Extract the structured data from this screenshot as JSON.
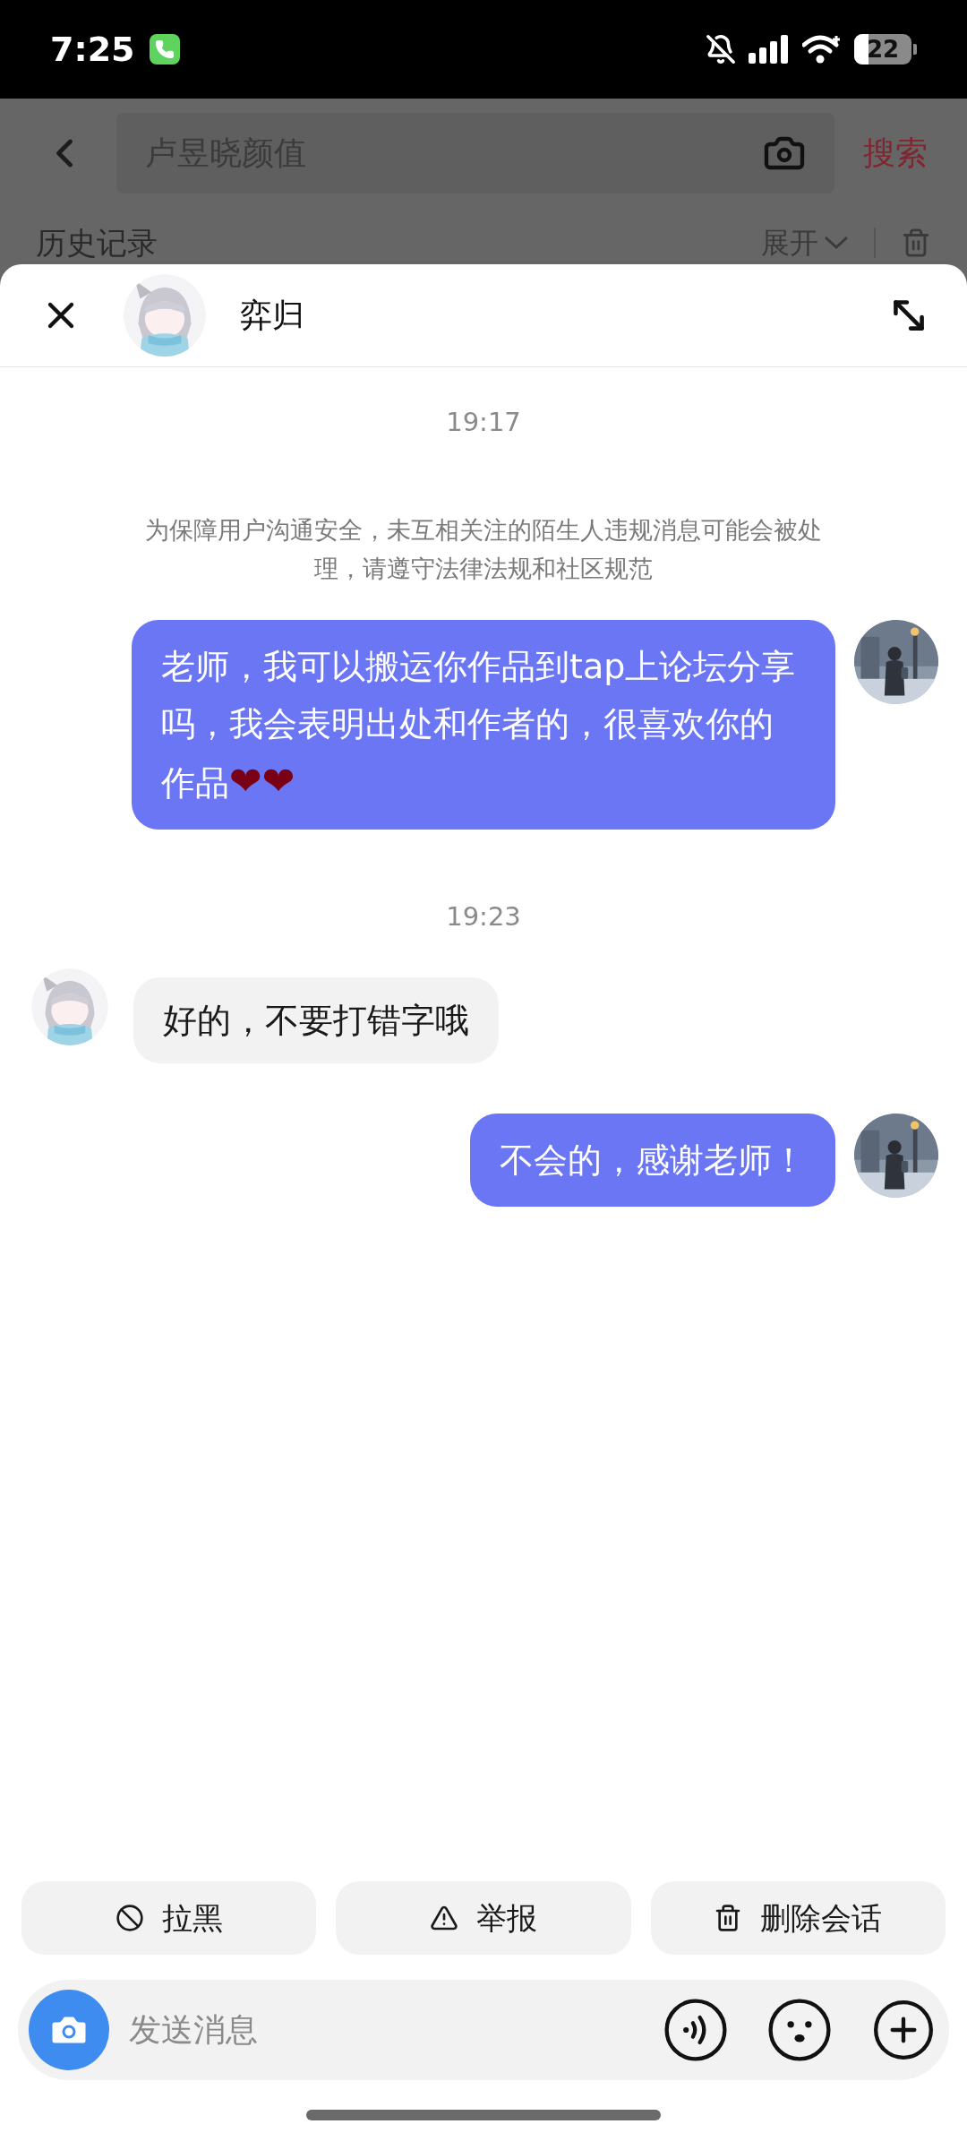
{
  "status_bar": {
    "time": "7:25",
    "battery": "22"
  },
  "background_page": {
    "search": {
      "placeholder": "卢昱晓颜值"
    },
    "search_button": "搜索",
    "history_title": "历史记录",
    "expand_label": "展开"
  },
  "chat": {
    "contact_name": "弈归"
  },
  "messages": [
    {
      "kind": "time",
      "text": "19:17"
    },
    {
      "kind": "notice",
      "text": "为保障用户沟通安全，未互相关注的陌生人违规消息可能会被处理，请遵守法律法规和社区规范"
    },
    {
      "kind": "sent",
      "text": "老师，我可以搬运你作品到tap上论坛分享吗，我会表明出处和作者的，很喜欢你的作品",
      "emoji": "❤❤"
    },
    {
      "kind": "time",
      "text": "19:23"
    },
    {
      "kind": "received",
      "text": "好的，不要打错字哦"
    },
    {
      "kind": "sent",
      "text": "不会的，感谢老师！"
    }
  ],
  "actions": [
    {
      "kind": "block",
      "label": "拉黑"
    },
    {
      "kind": "report",
      "label": "举报"
    },
    {
      "kind": "delete",
      "label": "删除会话"
    }
  ],
  "composer": {
    "placeholder": "发送消息"
  }
}
